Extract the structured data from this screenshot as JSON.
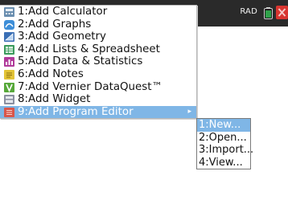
{
  "status": {
    "mode": "RAD"
  },
  "menu": {
    "items": [
      {
        "label": "1:Add Calculator",
        "icon": "calculator-icon",
        "color": "#6b8fb0"
      },
      {
        "label": "2:Add Graphs",
        "icon": "graphs-icon",
        "color": "#3d8ed8"
      },
      {
        "label": "3:Add Geometry",
        "icon": "geometry-icon",
        "color": "#3a6fb5"
      },
      {
        "label": "4:Add Lists & Spreadsheet",
        "icon": "spreadsheet-icon",
        "color": "#3c9b5c"
      },
      {
        "label": "5:Add Data & Statistics",
        "icon": "statistics-icon",
        "color": "#b03a9a"
      },
      {
        "label": "6:Add Notes",
        "icon": "notes-icon",
        "color": "#e3c437"
      },
      {
        "label": "7:Add Vernier DataQuest™",
        "icon": "dataquest-icon",
        "color": "#57a83a"
      },
      {
        "label": "8:Add Widget",
        "icon": "widget-icon",
        "color": "#8a8fa0"
      },
      {
        "label": "9:Add Program Editor",
        "icon": "program-editor-icon",
        "color": "#d9564a",
        "highlighted": true
      }
    ]
  },
  "submenu": {
    "items": [
      {
        "label": "1:New...",
        "highlighted": true
      },
      {
        "label": "2:Open..."
      },
      {
        "label": "3:Import..."
      },
      {
        "label": "4:View..."
      }
    ]
  },
  "colors": {
    "highlight": "#7fb6e6",
    "titlebar": "#2a2a2a",
    "close": "#d8352f",
    "battery": "#2fa24a"
  }
}
